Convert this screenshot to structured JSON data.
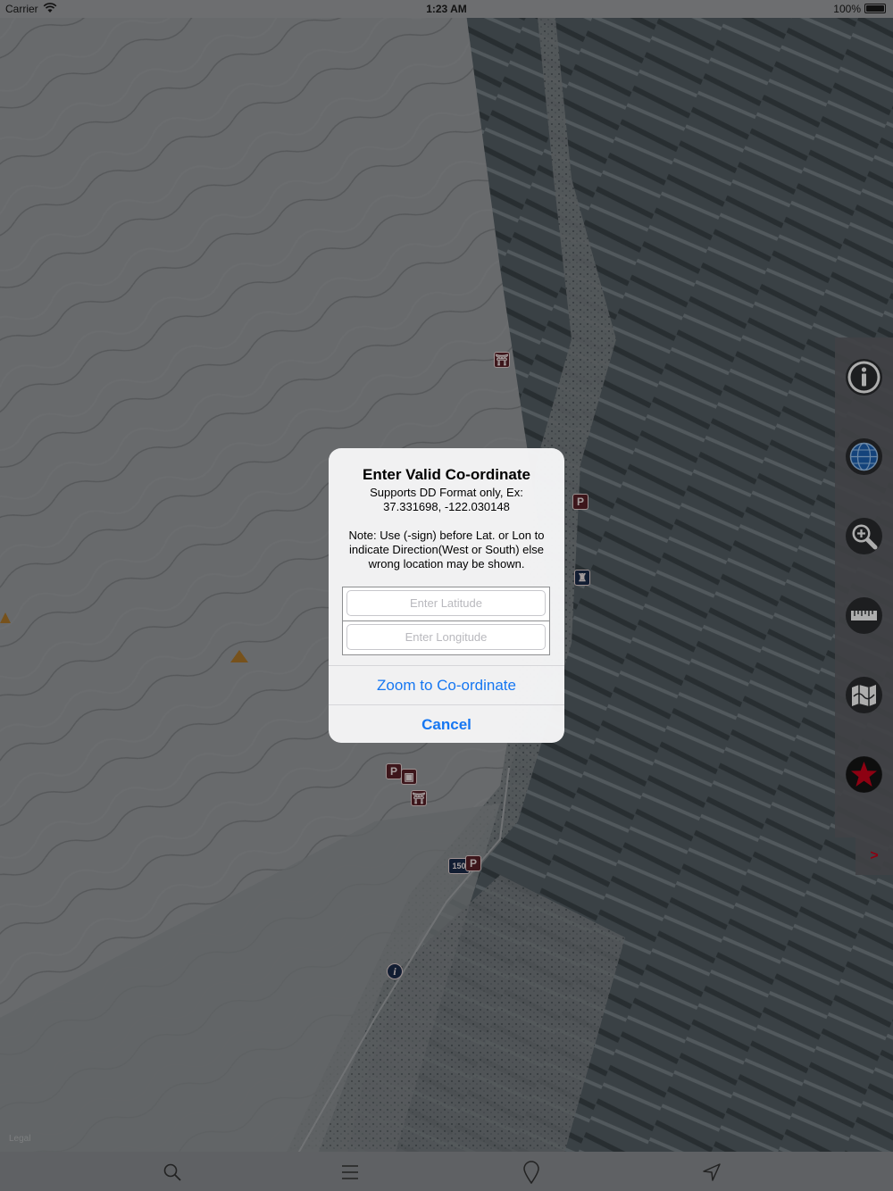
{
  "status_bar": {
    "carrier": "Carrier",
    "time": "1:23 AM",
    "battery_percent": "100%"
  },
  "alert": {
    "title": "Enter Valid Co-ordinate",
    "message": "Supports DD Format only, Ex:\n37.331698, -122.030148\n\nNote: Use (-sign) before Lat. or Lon to indicate Direction(West or South) else wrong location may be shown.",
    "latitude_placeholder": "Enter Latitude",
    "longitude_placeholder": "Enter Longitude",
    "latitude_value": "",
    "longitude_value": "",
    "zoom_button": "Zoom to Co-ordinate",
    "cancel_button": "Cancel",
    "accent_color": "#1677f2"
  },
  "sidebar": {
    "buttons": [
      "info-icon",
      "globe-icon",
      "zoom-in-icon",
      "ruler-icon",
      "map-layers-icon",
      "favorites-star-icon"
    ],
    "expand_label": ">"
  },
  "map": {
    "legal_label": "Legal",
    "markers": [
      "P",
      "P",
      "P",
      "150",
      "i"
    ]
  },
  "tab_bar": {
    "items": [
      "search-icon",
      "list-icon",
      "pin-icon",
      "location-arrow-icon"
    ]
  }
}
